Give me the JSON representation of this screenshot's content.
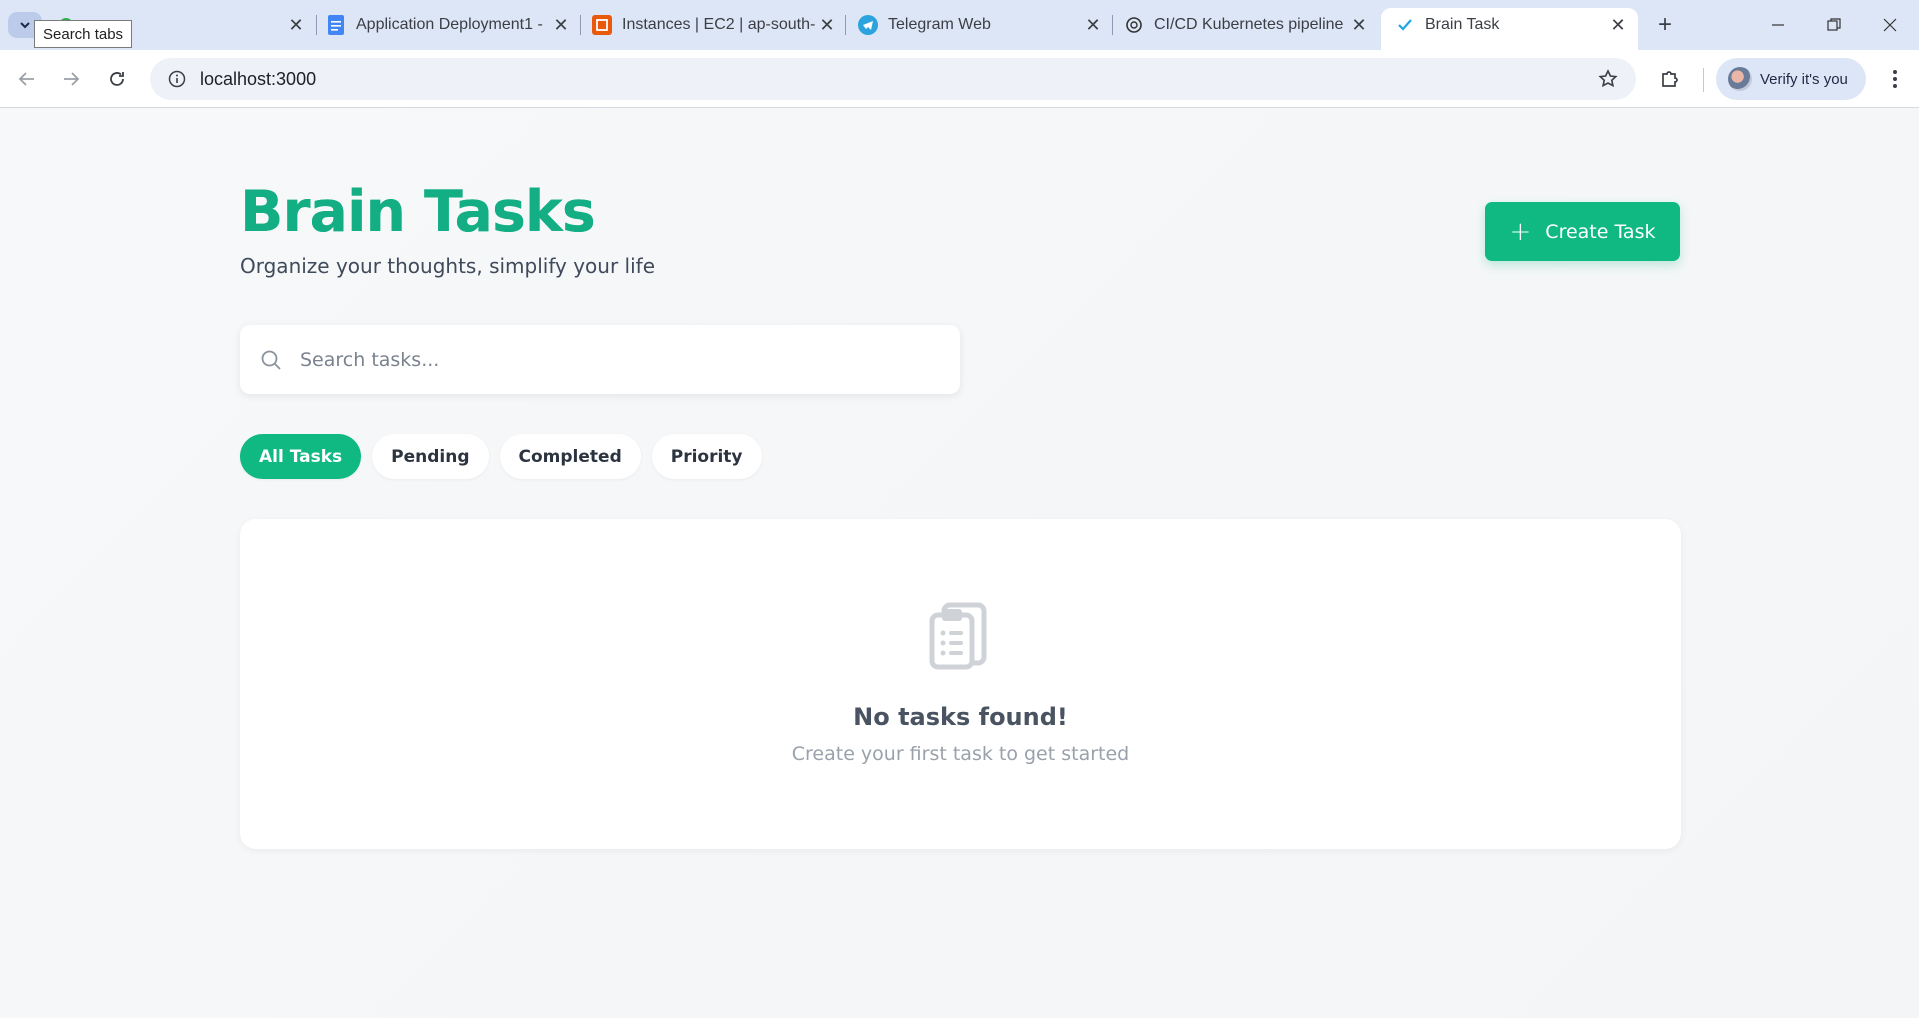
{
  "browser": {
    "tooltip": "Search tabs",
    "tabs": [
      {
        "title": "Application Deployment1 -",
        "icon": "docs-icon"
      },
      {
        "title": "Instances | EC2 | ap-south-",
        "icon": "aws-icon"
      },
      {
        "title": "Telegram Web",
        "icon": "telegram-icon"
      },
      {
        "title": "CI/CD Kubernetes pipeline",
        "icon": "openai-icon"
      },
      {
        "title": "Brain Task",
        "icon": "checkmark-icon",
        "active": true
      }
    ],
    "url": "localhost:3000",
    "profile_label": "Verify it's you"
  },
  "app": {
    "title": "Brain Tasks",
    "subtitle": "Organize your thoughts, simplify your life",
    "create_label": "Create Task",
    "search_placeholder": "Search tasks...",
    "filters": [
      "All Tasks",
      "Pending",
      "Completed",
      "Priority"
    ],
    "active_filter": "All Tasks",
    "empty_title": "No tasks found!",
    "empty_subtitle": "Create your first task to get started"
  },
  "colors": {
    "accent": "#10b981",
    "title": "#14ae84",
    "tabstrip": "#dde6f6"
  }
}
